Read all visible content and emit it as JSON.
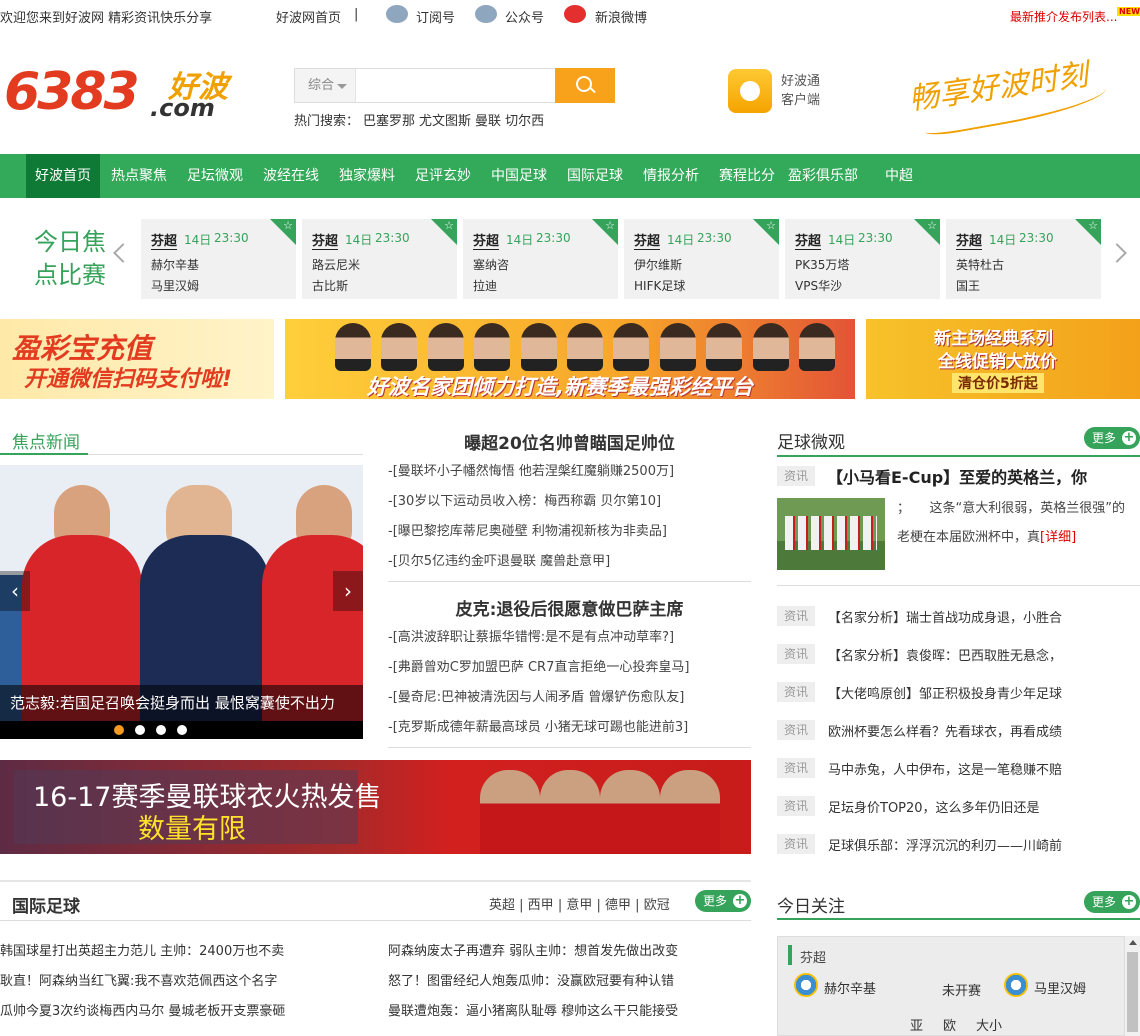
{
  "topbar": {
    "welcome": "欢迎您来到好波网 精彩资讯快乐分享",
    "home_link": "好波网首页",
    "divider": "|",
    "subscribe": "订阅号",
    "official": "公众号",
    "weibo": "新浪微博",
    "latest": "最新推介发布列表...",
    "new_badge": "NEW"
  },
  "logo": {
    "number": "6383",
    "name": "好波",
    "domain": ".com"
  },
  "search": {
    "category": "综合",
    "placeholder": "",
    "hot_label": "热门搜索：",
    "hot_terms": [
      "巴塞罗那",
      "尤文图斯",
      "曼联",
      "切尔西"
    ]
  },
  "app": {
    "line1": "好波通",
    "line2": "客户端"
  },
  "slogan": "畅享好波时刻",
  "nav": [
    "好波首页",
    "热点聚焦",
    "足坛微观",
    "波经在线",
    "独家爆料",
    "足评玄妙",
    "中国足球",
    "国际足球",
    "情报分析",
    "赛程比分",
    "盈彩俱乐部",
    "中超"
  ],
  "focus": {
    "title": "今日焦点比赛",
    "matches": [
      {
        "league": "芬超",
        "date": "14日",
        "time": "23:30",
        "home": "赫尔辛基",
        "away": "马里汉姆"
      },
      {
        "league": "芬超",
        "date": "14日",
        "time": "23:30",
        "home": "路云尼米",
        "away": "古比斯"
      },
      {
        "league": "芬超",
        "date": "14日",
        "time": "23:30",
        "home": "塞纳咨",
        "away": "拉迪"
      },
      {
        "league": "芬超",
        "date": "14日",
        "time": "23:30",
        "home": "伊尔维斯",
        "away": "HIFK足球"
      },
      {
        "league": "芬超",
        "date": "14日",
        "time": "23:30",
        "home": "PK35万塔",
        "away": "VPS华沙"
      },
      {
        "league": "芬超",
        "date": "14日",
        "time": "23:30",
        "home": "英特杜古",
        "away": "国王"
      }
    ]
  },
  "banners": {
    "left_title": "盈彩宝充值",
    "left_sub": "开通微信扫码支付啦!",
    "mid": "好波名家团倾力打造,新赛季最强彩经平台",
    "right_line1": "新主场经典系列",
    "right_line2": "全线促销大放价",
    "right_line3": "清仓价5折起"
  },
  "focus_news": {
    "title": "焦点新闻",
    "caption": "范志毅:若国足召唤会挺身而出 最恨窝囊使不出力",
    "headline1": "曝超20位名帅曾瞄国足帅位",
    "list1": [
      "-[曼联坏小子幡然悔悟 他若涅槃红魔躺赚2500万]",
      "-[30岁以下运动员收入榜：梅西称霸 贝尔第10]",
      "-[曝巴黎挖库蒂尼奥碰壁 利物浦视新核为非卖品]",
      "-[贝尔5亿违约金吓退曼联 魔兽赴意甲]"
    ],
    "headline2": "皮克:退役后很愿意做巴萨主席",
    "list2": [
      "-[高洪波辞职让蔡振华错愕:是不是有点冲动草率?]",
      "-[弗爵曾劝C罗加盟巴萨 CR7直言拒绝一心投奔皇马]",
      "-[曼奇尼:巴神被清洗因与人闹矛盾 曾爆铲伤愈队友]",
      "-[克罗斯成德年薪最高球员 小猪无球可踢也能进前3]"
    ]
  },
  "weiguan": {
    "title": "足球微观",
    "more": "更多",
    "tag": "资讯",
    "top_title": "【小马看E-Cup】至爱的英格兰，你",
    "top_desc1": "；　　这条“意大利很弱，英格兰很强”的",
    "top_desc2": "老梗在本届欧洲杯中，真",
    "top_detail": "[详细]",
    "items": [
      "【名家分析】瑞士首战功成身退，小胜合",
      "【名家分析】袁俊晖：巴西取胜无悬念，",
      "【大佬鸣原创】邹正积极投身青少年足球",
      "欧洲杯要怎么样看？先看球衣，再看成绩",
      "马中赤兔，人中伊布，这是一笔稳赚不赔",
      "足坛身价TOP20，这么多年仍旧还是",
      "足球俱乐部：浮浮沉沉的利刃——川崎前"
    ]
  },
  "big_banner": {
    "line1": "16-17赛季曼联球衣火热发售",
    "line2": "数量有限"
  },
  "intl": {
    "title": "国际足球",
    "tabs": [
      "英超",
      "西甲",
      "意甲",
      "德甲",
      "欧冠"
    ],
    "more": "更多",
    "left": [
      "韩国球星打出英超主力范儿 主帅：2400万也不卖",
      "耿直！阿森纳当红飞翼:我不喜欢范佩西这个名字",
      "瓜帅今夏3次约谈梅西内马尔 曼城老板开支票豪砸"
    ],
    "right": [
      "阿森纳废太子再遭弃 弱队主帅：想首发先做出改变",
      "怒了！图雷经纪人炮轰瓜帅：没赢欧冠要有种认错",
      "曼联遭炮轰：逼小猪离队耻辱 穆帅这么干只能接受"
    ]
  },
  "today": {
    "title": "今日关注",
    "more": "更多",
    "league": "芬超",
    "home": "赫尔辛基",
    "status": "未开赛",
    "away": "马里汉姆",
    "odds": [
      "亚",
      "欧",
      "大小"
    ]
  },
  "colors": {
    "brand_green": "#35a35a",
    "nav_green": "#33a95a",
    "nav_active": "#0e7a35",
    "search_orange": "#f8a21c",
    "logo_red": "#e23b1f"
  }
}
